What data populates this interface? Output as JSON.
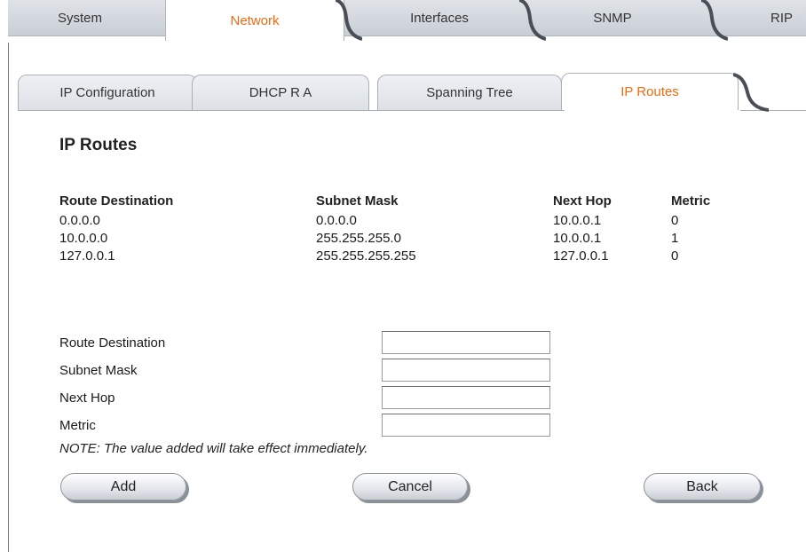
{
  "top_tabs": [
    {
      "label": "System",
      "active": false
    },
    {
      "label": "Network",
      "active": true
    },
    {
      "label": "Interfaces",
      "active": false
    },
    {
      "label": "SNMP",
      "active": false
    },
    {
      "label": "RIP",
      "active": false
    }
  ],
  "sub_tabs": [
    {
      "label": "IP Configuration",
      "active": false
    },
    {
      "label": "DHCP R A",
      "active": false
    },
    {
      "label": "Spanning Tree",
      "active": false
    },
    {
      "label": "IP Routes",
      "active": true
    }
  ],
  "page_title": "IP Routes",
  "routes_table": {
    "headers": [
      "Route Destination",
      "Subnet Mask",
      "Next Hop",
      "Metric"
    ],
    "rows": [
      [
        "0.0.0.0",
        "0.0.0.0",
        "10.0.0.1",
        "0"
      ],
      [
        "10.0.0.0",
        "255.255.255.0",
        "10.0.0.1",
        "1"
      ],
      [
        "127.0.0.1",
        "255.255.255.255",
        "127.0.0.1",
        "0"
      ]
    ]
  },
  "form": {
    "fields": [
      {
        "label": "Route Destination",
        "value": ""
      },
      {
        "label": "Subnet Mask",
        "value": ""
      },
      {
        "label": "Next Hop",
        "value": ""
      },
      {
        "label": "Metric",
        "value": ""
      }
    ],
    "note": "NOTE: The value added will take effect immediately."
  },
  "buttons": {
    "add": "Add",
    "cancel": "Cancel",
    "back": "Back"
  },
  "colors": {
    "active_tab_text": "#f06a12",
    "tab_background": "#dfe3e8"
  }
}
